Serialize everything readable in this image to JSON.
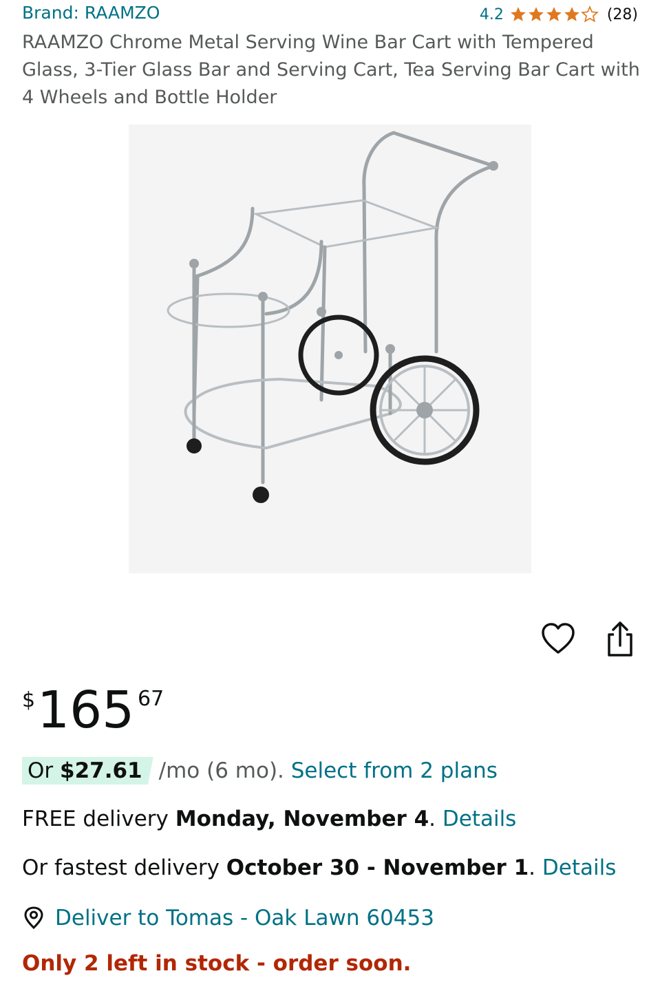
{
  "brand": {
    "label": "Brand: RAAMZO"
  },
  "rating": {
    "value": "4.2",
    "stars": 4.2,
    "count": "(28)"
  },
  "product": {
    "title": "RAAMZO Chrome Metal Serving Wine Bar Cart with Tempered Glass, 3-Tier Glass Bar and Serving Cart, Tea Serving Bar Cart with 4 Wheels and Bottle Holder"
  },
  "icons": {
    "wishlist": "heart-icon",
    "share": "share-icon",
    "location": "location-pin-icon"
  },
  "price": {
    "symbol": "$",
    "whole": "165",
    "fraction": "67"
  },
  "installment": {
    "or": "Or ",
    "amount": "$27.61",
    "term": "/mo (6 mo). ",
    "plans_link": "Select from 2 plans"
  },
  "delivery": {
    "prefix": "FREE delivery ",
    "date": "Monday, November 4",
    "period": ". ",
    "details_link": "Details"
  },
  "fastest": {
    "prefix": "Or fastest delivery ",
    "date": "October 30 - November 1",
    "period": ". ",
    "details_link": "Details"
  },
  "location": {
    "label": "Deliver to Tomas - Oak Lawn 60453"
  },
  "stock": {
    "label": "Only 2 left in stock - order soon."
  },
  "colors": {
    "link": "#007185",
    "star": "#de7921",
    "stock": "#b12704",
    "badge": "#d4f4e8"
  }
}
